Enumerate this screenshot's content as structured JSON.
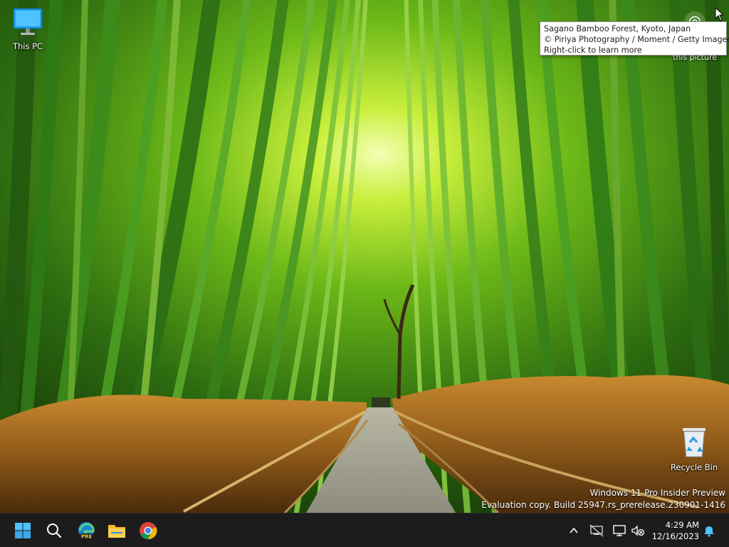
{
  "desktop": {
    "icons": [
      {
        "label": "This PC",
        "icon": "monitor-icon"
      },
      {
        "label": "Recycle Bin",
        "icon": "recycle-bin-icon"
      }
    ]
  },
  "spotlight": {
    "button_caption": "this picture",
    "tooltip": {
      "line1": "Sagano Bamboo Forest, Kyoto, Japan",
      "line2": "© Piriya Photography / Moment / Getty Images",
      "line3": "Right-click to learn more"
    }
  },
  "watermark": {
    "line1": "Windows 11 Pro Insider Preview",
    "line2": "Evaluation copy. Build 25947.rs_prerelease.230901-1416"
  },
  "taskbar": {
    "apps": [
      {
        "name": "start-icon"
      },
      {
        "name": "search-icon"
      },
      {
        "name": "edge-icon",
        "badge": "PRE"
      },
      {
        "name": "file-explorer-icon"
      },
      {
        "name": "chrome-icon"
      }
    ],
    "tray": {
      "time": "4:29 AM",
      "date": "12/16/2023"
    }
  },
  "colors": {
    "taskbar_bg": "#1c1c1c",
    "start_blue": "#4cc2ff",
    "bell_blue": "#4cc2ff"
  }
}
